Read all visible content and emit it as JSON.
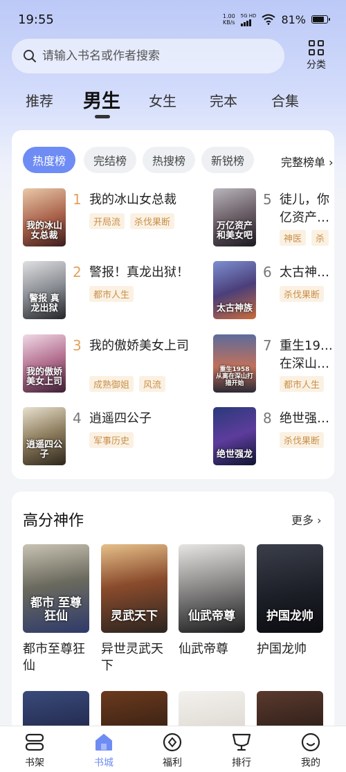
{
  "status": {
    "time": "19:55",
    "net_speed": "1.00",
    "net_unit": "KB/s",
    "signal_label": "5G HD",
    "battery": "81%",
    "battery_level": 0.81
  },
  "search": {
    "placeholder": "请输入书名或作者搜索"
  },
  "category": {
    "label": "分类"
  },
  "tabs": [
    {
      "label": "推荐"
    },
    {
      "label": "男生",
      "active": true
    },
    {
      "label": "女生"
    },
    {
      "label": "完本"
    },
    {
      "label": "合集"
    }
  ],
  "rank_tabs": [
    {
      "label": "热度榜",
      "active": true
    },
    {
      "label": "完结榜"
    },
    {
      "label": "热搜榜"
    },
    {
      "label": "新锐榜"
    }
  ],
  "rank_more": "完整榜单",
  "rank_list": [
    {
      "rank": "1",
      "title": "我的冰山女总裁",
      "tags": [
        "开局流",
        "杀伐果断"
      ],
      "cover_text": "我的冰山女总裁"
    },
    {
      "rank": "2",
      "title": "警报！真龙出狱！",
      "tags": [
        "都市人生"
      ],
      "cover_text": "警报 真龙出狱"
    },
    {
      "rank": "3",
      "title": "我的傲娇美女上司",
      "tags": [
        "成熟御姐",
        "风流"
      ],
      "cover_text": "我的傲娇美女上司"
    },
    {
      "rank": "4",
      "title": "逍遥四公子",
      "tags": [
        "军事历史"
      ],
      "cover_text": "逍遥四公子"
    },
    {
      "rank": "5",
      "title": "徒儿，你亿资产…",
      "tags": [
        "神医",
        "杀"
      ],
      "cover_text": "万亿资产 和美女吧"
    },
    {
      "rank": "6",
      "title": "太古神…",
      "tags": [
        "杀伐果断"
      ],
      "cover_text": "太古神族"
    },
    {
      "rank": "7",
      "title": "重生19…在深山…",
      "tags": [
        "都市人生"
      ],
      "cover_text": "重生1958 从离在深山打猎开始"
    },
    {
      "rank": "8",
      "title": "绝世强…",
      "tags": [
        "杀伐果断"
      ],
      "cover_text": "绝世强龙"
    }
  ],
  "highscore": {
    "title": "高分神作",
    "more": "更多",
    "books": [
      {
        "name": "都市至尊狂仙",
        "cover_text": "都市 至尊狂仙"
      },
      {
        "name": "异世灵武天下",
        "cover_text": "灵武天下"
      },
      {
        "name": "仙武帝尊",
        "cover_text": "仙武帝尊"
      },
      {
        "name": "护国龙帅",
        "cover_text": "护国龙帅"
      }
    ]
  },
  "bottom_nav": [
    {
      "label": "书架"
    },
    {
      "label": "书城",
      "active": true
    },
    {
      "label": "福利"
    },
    {
      "label": "排行"
    },
    {
      "label": "我的"
    }
  ],
  "colors": {
    "accent": "#6e8cf3",
    "tag_text": "#c8904a",
    "tag_bg": "#fbf1e3",
    "rank_top": "#e3a15c"
  }
}
